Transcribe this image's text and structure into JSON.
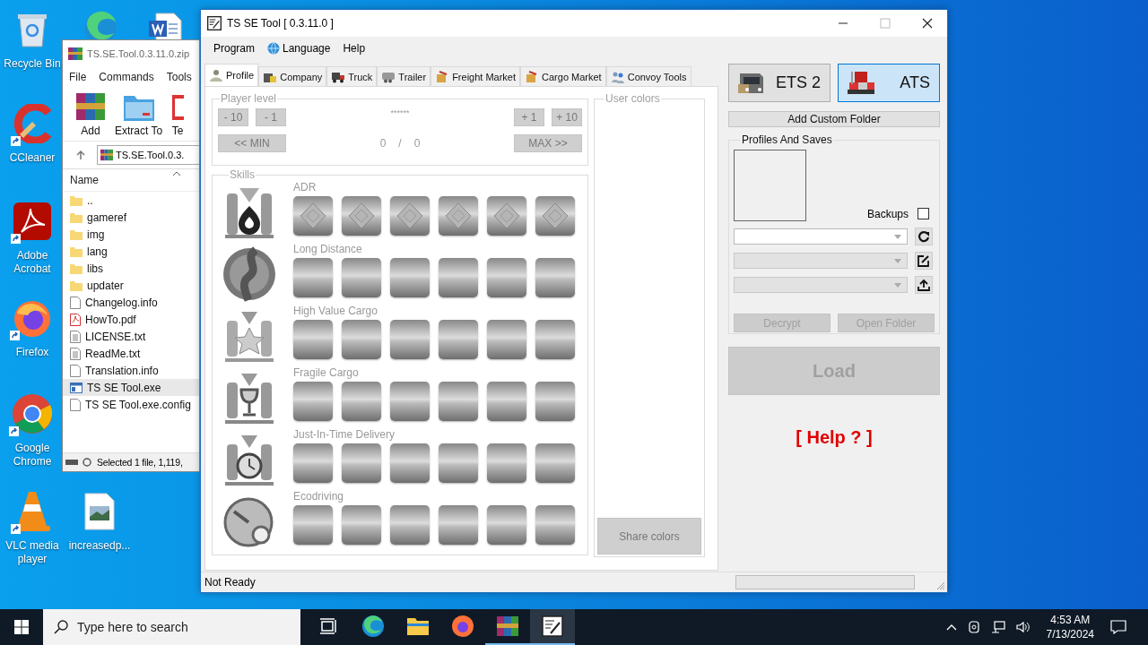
{
  "desktop": {
    "icons": [
      {
        "kind": "recycle-bin",
        "label": "Recycle Bin"
      },
      {
        "kind": "edge"
      },
      {
        "kind": "word"
      },
      {
        "kind": "ccleaner",
        "label": "CCleaner",
        "shortcut": true
      },
      {
        "kind": "acrobat",
        "label": "Adobe Acrobat",
        "shortcut": true
      },
      {
        "kind": "firefox",
        "label": "Firefox",
        "shortcut": true
      },
      {
        "kind": "chrome",
        "label": "Google Chrome",
        "shortcut": true
      },
      {
        "kind": "vlc",
        "label": "VLC media player",
        "shortcut": true
      },
      {
        "kind": "image-file",
        "label": "increasedp..."
      }
    ]
  },
  "archive_window": {
    "title": "TS.SE.Tool.0.3.11.0.zip",
    "menu": [
      "File",
      "Commands",
      "Tools"
    ],
    "toolbar": [
      {
        "kind": "add",
        "label": "Add"
      },
      {
        "kind": "extract",
        "label": "Extract To"
      },
      {
        "kind": "test",
        "label": "Te"
      }
    ],
    "path": "TS.SE.Tool.0.3.",
    "column": "Name",
    "files": [
      {
        "kind": "folder",
        "name": "..",
        "selected": false
      },
      {
        "kind": "folder",
        "name": "gameref",
        "selected": false
      },
      {
        "kind": "folder",
        "name": "img",
        "selected": false
      },
      {
        "kind": "folder",
        "name": "lang",
        "selected": false
      },
      {
        "kind": "folder",
        "name": "libs",
        "selected": false
      },
      {
        "kind": "folder",
        "name": "updater",
        "selected": false
      },
      {
        "kind": "file",
        "name": "Changelog.info",
        "selected": false
      },
      {
        "kind": "pdf",
        "name": "HowTo.pdf",
        "selected": false
      },
      {
        "kind": "text",
        "name": "LICENSE.txt",
        "selected": false
      },
      {
        "kind": "text",
        "name": "ReadMe.txt",
        "selected": false
      },
      {
        "kind": "file",
        "name": "Translation.info",
        "selected": false
      },
      {
        "kind": "exe",
        "name": "TS SE Tool.exe",
        "selected": true
      },
      {
        "kind": "file",
        "name": "TS SE Tool.exe.config",
        "selected": false
      }
    ],
    "status": "Selected 1 file, 1,119,"
  },
  "tool_window": {
    "title": "TS SE Tool [ 0.3.11.0 ]",
    "menu": [
      {
        "kind": "plain",
        "label": "Program"
      },
      {
        "kind": "globe",
        "label": "Language"
      },
      {
        "kind": "plain",
        "label": "Help"
      }
    ],
    "tabs": [
      {
        "kind": "person",
        "label": "Profile",
        "selected": true
      },
      {
        "kind": "building",
        "label": "Company",
        "selected": false
      },
      {
        "kind": "truck",
        "label": "Truck",
        "selected": false
      },
      {
        "kind": "trailer",
        "label": "Trailer",
        "selected": false
      },
      {
        "kind": "crate",
        "label": "Freight Market",
        "selected": false
      },
      {
        "kind": "crate",
        "label": "Cargo Market",
        "selected": false
      },
      {
        "kind": "people",
        "label": "Convoy Tools",
        "selected": false
      }
    ],
    "player_level": {
      "title": "Player level",
      "minus_buttons": [
        "- 10",
        "- 1"
      ],
      "plus_buttons": [
        "+ 1",
        "+ 10"
      ],
      "level_name": "******",
      "min_button": "<< MIN",
      "max_button": "MAX >>",
      "current": "0",
      "separator": "/",
      "maximum": "0"
    },
    "skills": {
      "title": "Skills",
      "rows": [
        {
          "kind": "adr",
          "label": "ADR"
        },
        {
          "kind": "road",
          "label": "Long Distance"
        },
        {
          "kind": "star",
          "label": "High Value Cargo"
        },
        {
          "kind": "glass",
          "label": "Fragile Cargo"
        },
        {
          "kind": "clock",
          "label": "Just-In-Time Delivery"
        },
        {
          "kind": "gauge",
          "label": "Ecodriving"
        }
      ]
    },
    "user_colors": {
      "title": "User colors",
      "button": "Share colors"
    },
    "games": [
      {
        "kind": "eu",
        "label": "ETS 2",
        "selected": false
      },
      {
        "kind": "us",
        "label": "ATS",
        "selected": true
      }
    ],
    "add_folder_button": "Add Custom Folder",
    "profiles": {
      "title": "Profiles And Saves",
      "backups": {
        "label": "Backups",
        "checked": false
      },
      "dropdowns": [
        {
          "kind": "refresh",
          "disabled": false
        },
        {
          "kind": "edit",
          "disabled": true
        },
        {
          "kind": "upload",
          "disabled": true
        }
      ],
      "buttons": [
        {
          "label": "Decrypt",
          "disabled": true
        },
        {
          "label": "Open Folder",
          "disabled": true
        }
      ]
    },
    "load_button": {
      "label": "Load",
      "disabled": true
    },
    "help_link": "[ Help ? ]",
    "status": "Not Ready",
    "progress": {
      "level": 0
    }
  },
  "taskbar": {
    "search": {
      "placeholder": "Type here to search"
    },
    "apps": [
      {
        "kind": "task-view",
        "open": false,
        "selected": false
      },
      {
        "kind": "edge",
        "open": false,
        "selected": false
      },
      {
        "kind": "explorer",
        "open": false,
        "selected": false
      },
      {
        "kind": "firefox",
        "open": false,
        "selected": false
      },
      {
        "kind": "winrar",
        "open": true,
        "selected": false
      },
      {
        "kind": "ts-tool",
        "open": true,
        "selected": true
      }
    ],
    "time": "4:53 AM",
    "date": "7/13/2024"
  }
}
